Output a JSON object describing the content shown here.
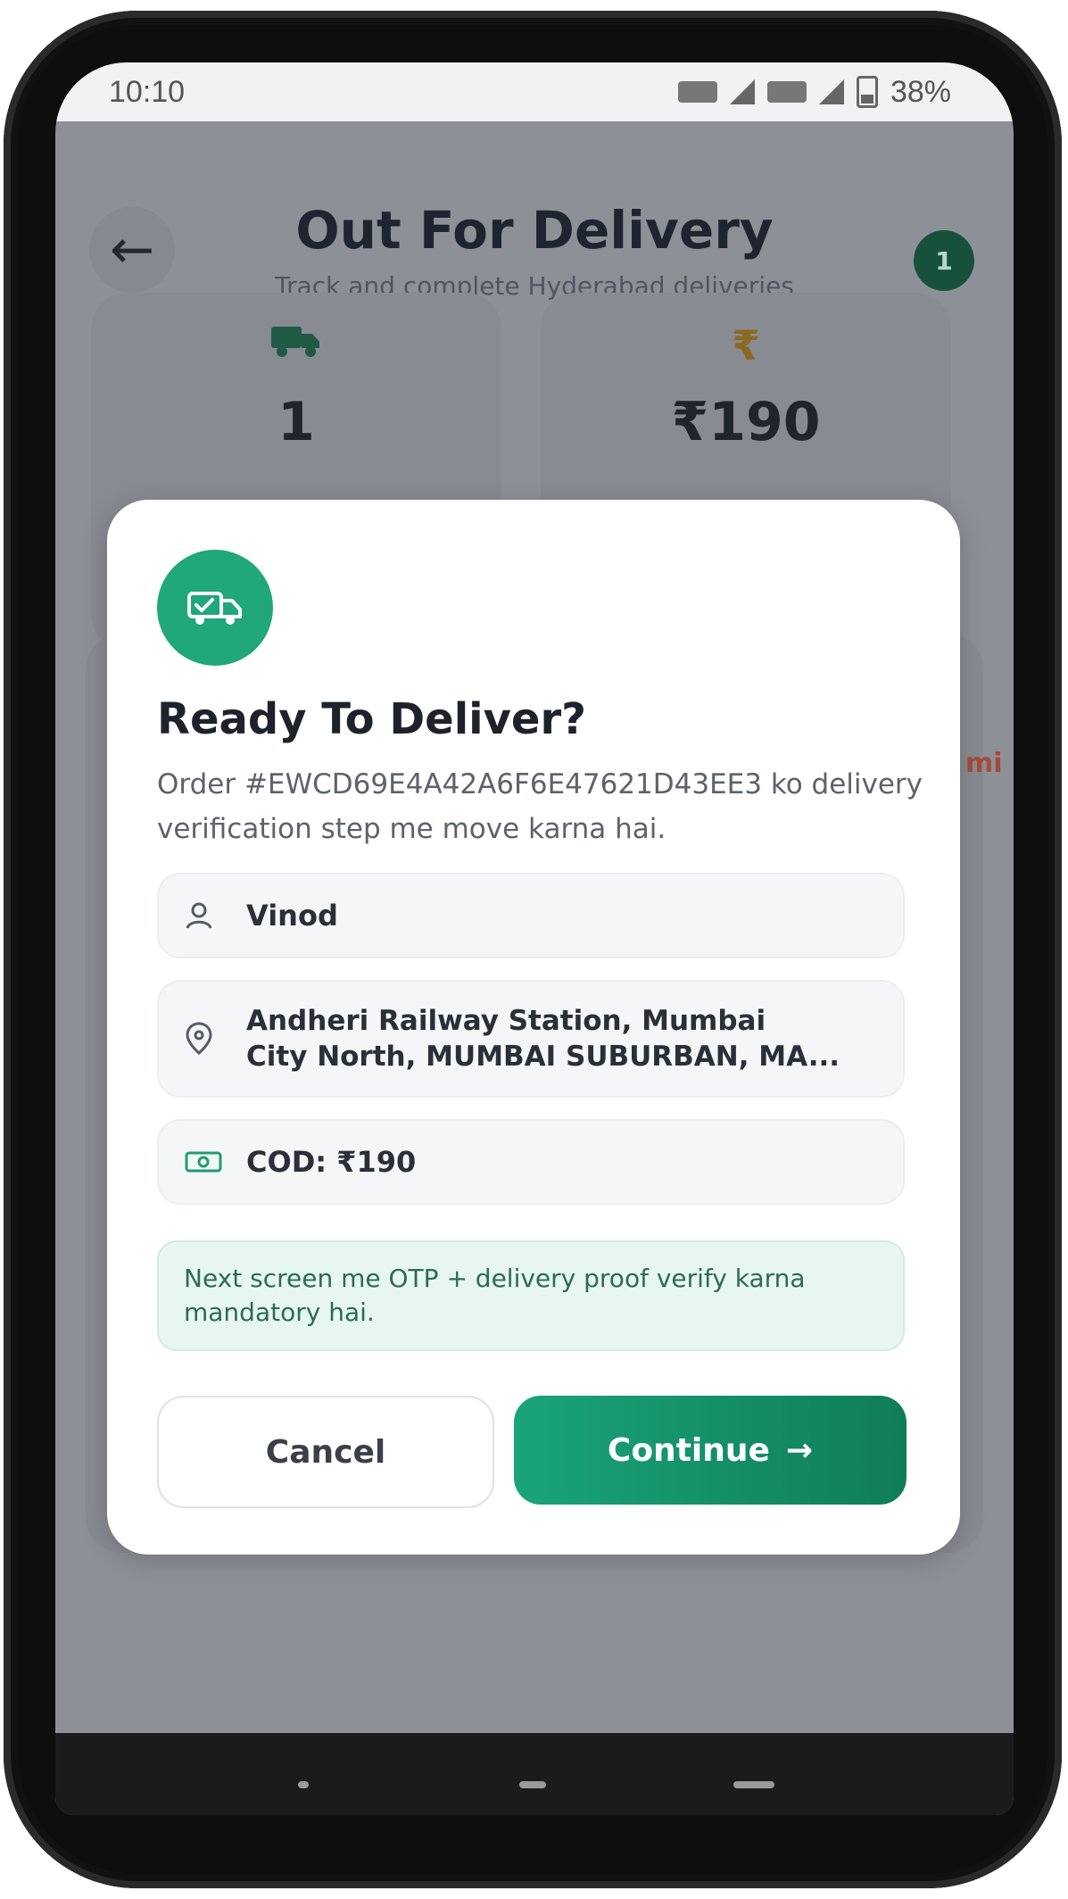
{
  "status_bar": {
    "time": "10:10",
    "battery": "38%"
  },
  "header": {
    "title": "Out For Delivery",
    "subtitle": "Track and complete Hyderabad deliveries",
    "badge_count": "1"
  },
  "stats": [
    {
      "icon": "truck-icon",
      "value": "1"
    },
    {
      "icon": "rupee-icon",
      "value": "₹190"
    }
  ],
  "background_text": "mi",
  "modal": {
    "icon": "delivery-truck-icon",
    "title": "Ready To Deliver?",
    "description": "Order #EWCD69E4A42A6F6E47621D43EE3 ko delivery verification step me move karna hai.",
    "customer_name": "Vinod",
    "address_line1": "Andheri Railway Station, Mumbai",
    "address_line2": "City North, MUMBAI SUBURBAN, MA...",
    "cod": "COD: ₹190",
    "note": "Next screen me OTP + delivery proof verify karna mandatory hai.",
    "cancel_label": "Cancel",
    "continue_label": "Continue"
  },
  "colors": {
    "accent": "#20a77a",
    "accent_dark": "#0f7d58",
    "note_bg": "#e7f7ef",
    "overlay": "#8e9098"
  }
}
